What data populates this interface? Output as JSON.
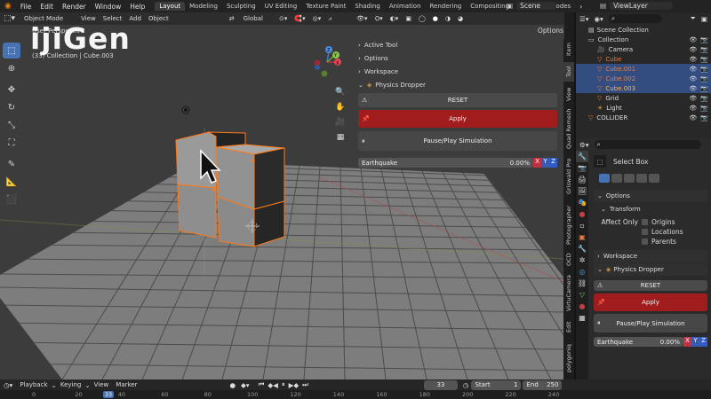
{
  "watermark": "ijiGen",
  "topbar": {
    "menus": [
      "File",
      "Edit",
      "Render",
      "Window",
      "Help"
    ],
    "workspaces": [
      "Layout",
      "Modeling",
      "Sculpting",
      "UV Editing",
      "Texture Paint",
      "Shading",
      "Animation",
      "Rendering",
      "Compositing",
      "Geometry Nodes"
    ],
    "scene": "Scene",
    "viewlayer": "ViewLayer"
  },
  "viewport": {
    "mode": "Object Mode",
    "menus": [
      "View",
      "Select",
      "Add",
      "Object"
    ],
    "transform": "Global",
    "options": "Options",
    "overlay_title": "User Perspective",
    "overlay_sub": "(33) Collection | Cube.003"
  },
  "npanel": {
    "sections": [
      "Active Tool",
      "Options",
      "Workspace"
    ],
    "physics_title": "Physics Dropper",
    "reset": "RESET",
    "apply": "Apply",
    "pause": "Pause/Play Simulation",
    "earthquake_label": "Earthquake",
    "earthquake_value": "0.00%",
    "axes": [
      "X",
      "Y",
      "Z"
    ]
  },
  "ntabs": [
    "Item",
    "Tool",
    "View",
    "Quad Remesh",
    "Griswald Pro",
    "Photographer",
    "OCD",
    "VirtuCamera",
    "Edit",
    "polygoniq"
  ],
  "outliner": {
    "header": "Scene Collection",
    "items": [
      {
        "name": "Collection",
        "indent": 1,
        "icon": "collection",
        "selected": false,
        "color": "#dcdcdc"
      },
      {
        "name": "Camera",
        "indent": 2,
        "icon": "camera",
        "selected": false,
        "color": "#dcdcdc"
      },
      {
        "name": "Cube",
        "indent": 2,
        "icon": "mesh",
        "selected": false,
        "color": "#e87d3e"
      },
      {
        "name": "Cube.001",
        "indent": 2,
        "icon": "mesh",
        "selected": true,
        "color": "#e87d3e"
      },
      {
        "name": "Cube.002",
        "indent": 2,
        "icon": "mesh",
        "selected": true,
        "color": "#e87d3e"
      },
      {
        "name": "Cube.003",
        "indent": 2,
        "icon": "mesh",
        "selected": true,
        "color": "#ffaf55"
      },
      {
        "name": "Grid",
        "indent": 2,
        "icon": "mesh",
        "selected": false,
        "color": "#dcdcdc"
      },
      {
        "name": "Light",
        "indent": 2,
        "icon": "light",
        "selected": false,
        "color": "#dcdcdc"
      },
      {
        "name": "COLLIDER",
        "indent": 1,
        "icon": "mesh",
        "selected": false,
        "color": "#dcdcdc"
      }
    ]
  },
  "props": {
    "tool_name": "Select Box",
    "options": "Options",
    "transform": "Transform",
    "affect_only": "Affect Only",
    "checks": [
      "Origins",
      "Locations",
      "Parents"
    ],
    "workspace": "Workspace",
    "physics_title": "Physics Dropper",
    "reset": "RESET",
    "apply": "Apply",
    "pause": "Pause/Play Simulation",
    "earthquake_label": "Earthquake",
    "earthquake_value": "0.00%"
  },
  "timeline": {
    "menus": [
      "Playback",
      "Keying",
      "View",
      "Marker"
    ],
    "current_frame": "33",
    "start_label": "Start",
    "start": "1",
    "end_label": "End",
    "end": "250",
    "ruler": [
      "0",
      "20",
      "33",
      "40",
      "60",
      "80",
      "100",
      "120",
      "140",
      "160",
      "180",
      "200",
      "220",
      "240"
    ]
  },
  "colors": {
    "accent": "#4772b3",
    "apply": "#a11d1d",
    "selection": "#ff7a1a"
  }
}
